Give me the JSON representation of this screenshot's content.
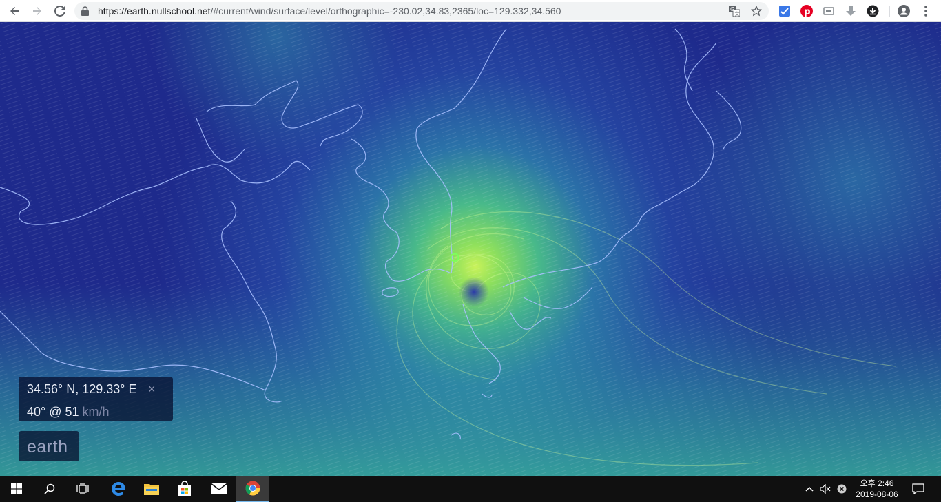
{
  "browser": {
    "url_host": "https://earth.nullschool.net",
    "url_path": "/#current/wind/surface/level/orthographic=-230.02,34.83,2365/loc=129.332,34.560"
  },
  "overlay": {
    "coords": "34.56° N, 129.33° E",
    "close": "×",
    "wind_value": "40° @ 51",
    "wind_unit": "km/h",
    "earth_label": "earth"
  },
  "taskbar": {
    "clock_time": "오후 2:46",
    "clock_date": "2019-08-06"
  },
  "colors": {
    "ocean_dark": "#1e2a8c",
    "wind_mid": "#2a6aa8",
    "wind_fast": "#5fd08a",
    "wind_peak": "#b5f05a",
    "coastline": "#9cb8ff"
  },
  "icons": {
    "back": "arrow-left-icon",
    "forward": "arrow-right-icon",
    "reload": "reload-icon",
    "lock": "lock-icon",
    "translate": "translate-icon",
    "bookmark": "star-icon",
    "account": "account-icon",
    "menu": "kebab-menu-icon"
  }
}
